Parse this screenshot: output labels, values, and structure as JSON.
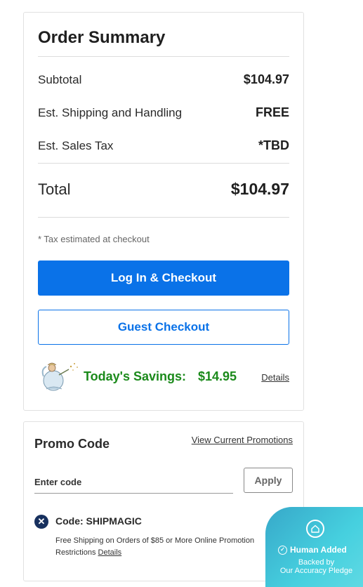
{
  "summary": {
    "title": "Order Summary",
    "subtotal_label": "Subtotal",
    "subtotal_value": "$104.97",
    "shipping_label": "Est. Shipping and Handling",
    "shipping_value": "FREE",
    "tax_label": "Est. Sales Tax",
    "tax_value": "*TBD",
    "total_label": "Total",
    "total_value": "$104.97",
    "tax_note": "* Tax estimated at checkout",
    "login_checkout_label": "Log In & Checkout",
    "guest_checkout_label": "Guest Checkout",
    "savings_label": "Today's Savings:",
    "savings_value": "$14.95",
    "savings_details": "Details"
  },
  "promo": {
    "title": "Promo Code",
    "view_promotions": "View Current Promotions",
    "input_placeholder": "Enter code",
    "apply_label": "Apply",
    "applied_code": "Code: SHIPMAGIC",
    "applied_desc": "Free Shipping on Orders of $85 or More Online Promotion Restrictions",
    "applied_details": "Details"
  },
  "badge": {
    "title": "Human Added",
    "line1": "Backed by",
    "line2": "Our Accuracy Pledge"
  },
  "colors": {
    "primary": "#0a72e8",
    "savings": "#1b8a1b",
    "badge": "#46d0df",
    "promo_icon": "#17305e"
  },
  "icons": {
    "savings": "fairy-icon",
    "remove_code": "close-circle-icon",
    "badge_top": "house-icon",
    "badge_check": "check-circle-icon"
  }
}
